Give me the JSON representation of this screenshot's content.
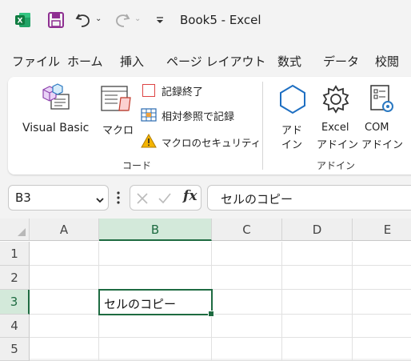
{
  "titlebar": {
    "title": "Book5  -  Excel",
    "icons": [
      "excel-logo-icon",
      "save-icon",
      "undo-icon",
      "redo-icon",
      "customize-quick-access-icon"
    ]
  },
  "menu": {
    "items": [
      "ファイル",
      "ホーム",
      "挿入",
      "ページ レイアウト",
      "数式",
      "データ",
      "校閲"
    ]
  },
  "ribbon": {
    "code_group": {
      "label": "コード",
      "visual_basic": "Visual Basic",
      "macro": "マクロ",
      "record_macro_stop": "記録終了",
      "relative_ref": "相対参照で記録",
      "macro_security": "マクロのセキュリティ"
    },
    "addin_group": {
      "label": "アドイン",
      "addin_line1": "アド",
      "addin_line2": "イン",
      "excel_addin_line1": "Excel",
      "excel_addin_line2": "アドイン",
      "com_addin_line1": "COM",
      "com_addin_line2": "アドイン"
    }
  },
  "formula_bar": {
    "name_box": "B3",
    "formula": "セルのコピー",
    "fx_label": "fx"
  },
  "grid": {
    "columns": [
      "A",
      "B",
      "C",
      "D",
      "E"
    ],
    "rows": [
      "1",
      "2",
      "3",
      "4",
      "5"
    ],
    "selected_cell": "B3",
    "b3_value": "セルのコピー"
  },
  "colors": {
    "excel_green": "#217346",
    "selection_green": "#1e6b41",
    "save_purple": "#8e2f91"
  }
}
